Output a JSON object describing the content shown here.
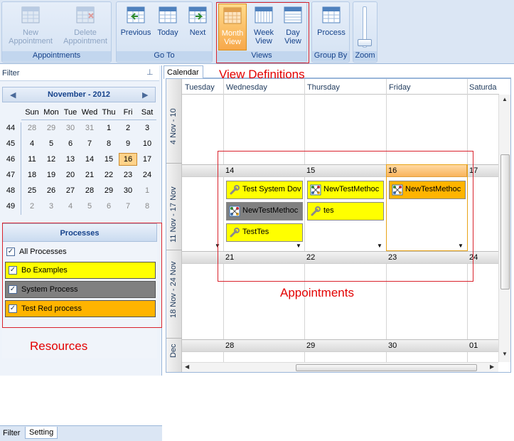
{
  "ribbon": {
    "groups": [
      {
        "label": "Appointments"
      },
      {
        "label": "Go To"
      },
      {
        "label": "Views"
      },
      {
        "label": "Group By"
      },
      {
        "label": "Zoom"
      }
    ],
    "new_appt_1": "New",
    "new_appt_2": "Appointment",
    "del_appt_1": "Delete",
    "del_appt_2": "Appointment",
    "previous": "Previous",
    "today": "Today",
    "next": "Next",
    "month_1": "Month",
    "month_2": "View",
    "week_1": "Week",
    "week_2": "View",
    "day_1": "Day",
    "day_2": "View",
    "process": "Process"
  },
  "left": {
    "filter_title": "Filter",
    "month_title": "November - 2012",
    "weekday_headers": [
      "Sun",
      "Mon",
      "Tue",
      "Wed",
      "Thu",
      "Fri",
      "Sat"
    ],
    "week_numbers": [
      "44",
      "45",
      "46",
      "47",
      "48",
      "49"
    ],
    "weeks": [
      [
        "28",
        "29",
        "30",
        "31",
        "1",
        "2",
        "3"
      ],
      [
        "4",
        "5",
        "6",
        "7",
        "8",
        "9",
        "10"
      ],
      [
        "11",
        "12",
        "13",
        "14",
        "15",
        "16",
        "17"
      ],
      [
        "18",
        "19",
        "20",
        "21",
        "22",
        "23",
        "24"
      ],
      [
        "25",
        "26",
        "27",
        "28",
        "29",
        "30",
        "1"
      ],
      [
        "2",
        "3",
        "4",
        "5",
        "6",
        "7",
        "8"
      ]
    ],
    "today": "16",
    "processes_title": "Processes",
    "all_processes": "All Processes",
    "resources": [
      {
        "name": "Bo Examples",
        "color": "#ffff00"
      },
      {
        "name": "System Process",
        "color": "#808080"
      },
      {
        "name": "Test Red process",
        "color": "#ffb400"
      }
    ],
    "tabs": [
      "Filter",
      "Setting"
    ]
  },
  "calendar": {
    "tab": "Calendar",
    "days": [
      "Tuesday",
      "Wednesday",
      "Thursday",
      "Friday",
      "Saturda"
    ],
    "week_labels": [
      "4 Nov - 10",
      "11 Nov - 17 Nov",
      "18 Nov - 24 Nov",
      "Dec"
    ],
    "row2_dates": [
      "14",
      "15",
      "16",
      "17"
    ],
    "row3_dates": [
      "21",
      "22",
      "23",
      "24"
    ],
    "row4_dates": [
      "28",
      "29",
      "30",
      "01"
    ],
    "appointments": [
      {
        "title": "Test System Dov",
        "color": "#ffff00",
        "icon": "wrench-icon"
      },
      {
        "title": "NewTestMethoc",
        "color": "#ffff00",
        "icon": "network-icon"
      },
      {
        "title": "NewTestMethoc",
        "color": "#ffb400",
        "icon": "network-icon"
      },
      {
        "title": "NewTestMethoc",
        "color": "#808080",
        "icon": "network-icon"
      },
      {
        "title": "tes",
        "color": "#ffff00",
        "icon": "wrench-icon"
      },
      {
        "title": "TestTes",
        "color": "#ffff00",
        "icon": "wrench-icon"
      }
    ]
  },
  "annotations": {
    "view_definitions": "View Definitions",
    "appointments": "Appointments",
    "resources": "Resources"
  },
  "colors": {
    "annotation": "#e30000",
    "accent": "#15428b",
    "today": "#ffd38a"
  }
}
